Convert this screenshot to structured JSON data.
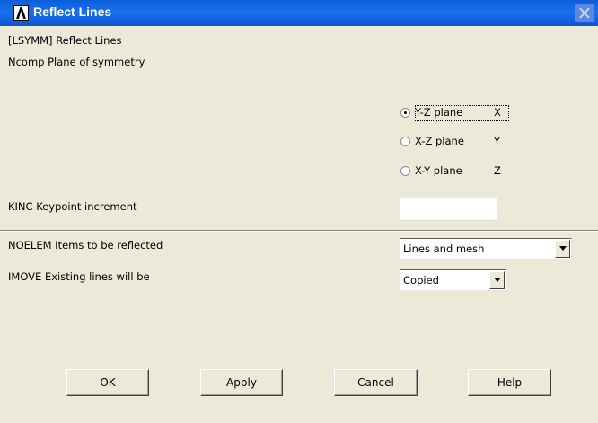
{
  "window": {
    "title": "Reflect Lines"
  },
  "header": {
    "command_label": "[LSYMM]  Reflect Lines",
    "ncomp_label": "Ncomp  Plane of symmetry"
  },
  "plane_options": [
    {
      "label": "Y-Z plane",
      "axis": "X",
      "selected": true
    },
    {
      "label": "X-Z plane",
      "axis": "Y",
      "selected": false
    },
    {
      "label": "X-Y plane",
      "axis": "Z",
      "selected": false
    }
  ],
  "kinc": {
    "label": "KINC    Keypoint increment",
    "value": "",
    "placeholder": ""
  },
  "noelem": {
    "label": "NOELEM  Items to be reflected",
    "selected": "Lines and mesh"
  },
  "imove": {
    "label": "IMOVE   Existing lines will be",
    "selected": "Copied"
  },
  "buttons": {
    "ok": "OK",
    "apply": "Apply",
    "cancel": "Cancel",
    "help": "Help"
  },
  "colors": {
    "titlebar": "#0a5fd8",
    "dialog_bg": "#ece9d8"
  }
}
